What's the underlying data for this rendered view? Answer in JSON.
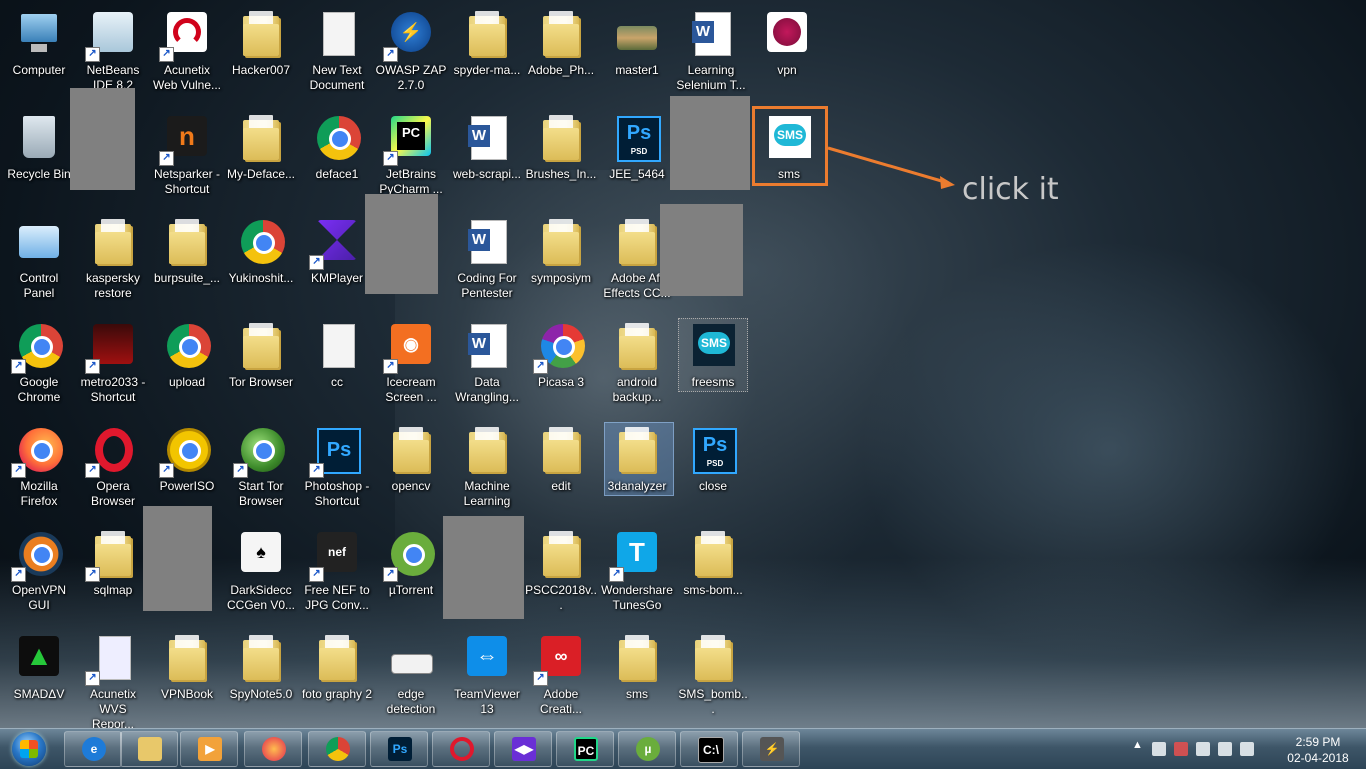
{
  "desktop": {
    "icons": [
      {
        "id": "computer",
        "label": "Computer"
      },
      {
        "id": "netbeans",
        "label": "NetBeans IDE 8.2"
      },
      {
        "id": "acunetix-web",
        "label": "Acunetix Web Vulne..."
      },
      {
        "id": "hacker007",
        "label": "Hacker007"
      },
      {
        "id": "new-text",
        "label": "New Text Document"
      },
      {
        "id": "owasp-zap",
        "label": "OWASP ZAP 2.7.0"
      },
      {
        "id": "spyder",
        "label": "spyder-ma..."
      },
      {
        "id": "adobe-ph",
        "label": "Adobe_Ph..."
      },
      {
        "id": "master1",
        "label": "master1"
      },
      {
        "id": "learning-selenium",
        "label": "Learning Selenium T..."
      },
      {
        "id": "vpn",
        "label": "vpn"
      },
      {
        "id": "recycle-bin",
        "label": "Recycle Bin"
      },
      {
        "id": "netsparker",
        "label": "Netsparker - Shortcut"
      },
      {
        "id": "my-deface",
        "label": "My-Deface..."
      },
      {
        "id": "deface1",
        "label": "deface1"
      },
      {
        "id": "pycharm",
        "label": "JetBrains PyCharm ..."
      },
      {
        "id": "web-scraping",
        "label": "web-scrapi..."
      },
      {
        "id": "brushes",
        "label": "Brushes_In..."
      },
      {
        "id": "jee",
        "label": "JEE_5464"
      },
      {
        "id": "sms",
        "label": "sms"
      },
      {
        "id": "control-panel",
        "label": "Control Panel"
      },
      {
        "id": "kaspersky",
        "label": "kaspersky restore"
      },
      {
        "id": "burpsuite",
        "label": "burpsuite_..."
      },
      {
        "id": "yukinoshita",
        "label": "Yukinoshit..."
      },
      {
        "id": "kmplayer",
        "label": "KMPlayer"
      },
      {
        "id": "coding-pentester",
        "label": "Coding For Pentester"
      },
      {
        "id": "symposiym",
        "label": "symposiym"
      },
      {
        "id": "adobe-ae",
        "label": "Adobe Aft Effects CC..."
      },
      {
        "id": "google-chrome",
        "label": "Google Chrome"
      },
      {
        "id": "metro2033",
        "label": "metro2033 - Shortcut"
      },
      {
        "id": "upload",
        "label": "upload"
      },
      {
        "id": "tor-browser",
        "label": "Tor Browser"
      },
      {
        "id": "cc",
        "label": "cc"
      },
      {
        "id": "icecream",
        "label": "Icecream Screen ..."
      },
      {
        "id": "data-wrangling",
        "label": "Data Wrangling..."
      },
      {
        "id": "picasa",
        "label": "Picasa 3"
      },
      {
        "id": "android-backup",
        "label": "android backup..."
      },
      {
        "id": "freesms",
        "label": "freesms"
      },
      {
        "id": "firefox",
        "label": "Mozilla Firefox"
      },
      {
        "id": "opera",
        "label": "Opera Browser"
      },
      {
        "id": "poweriso",
        "label": "PowerISO"
      },
      {
        "id": "start-tor",
        "label": "Start Tor Browser"
      },
      {
        "id": "photoshop",
        "label": "Photoshop - Shortcut"
      },
      {
        "id": "opencv",
        "label": "opencv"
      },
      {
        "id": "machine-learning",
        "label": "Machine Learning"
      },
      {
        "id": "edit",
        "label": "edit"
      },
      {
        "id": "3danalyzer",
        "label": "3danalyzer"
      },
      {
        "id": "close",
        "label": "close"
      },
      {
        "id": "openvpn",
        "label": "OpenVPN GUI"
      },
      {
        "id": "sqlmap",
        "label": "sqlmap"
      },
      {
        "id": "darksidecc",
        "label": "DarkSidecc CCGen V0..."
      },
      {
        "id": "free-nef",
        "label": "Free NEF to JPG Conv..."
      },
      {
        "id": "utorrent",
        "label": "µTorrent"
      },
      {
        "id": "pscc2018",
        "label": "PSCC2018v..."
      },
      {
        "id": "wondershare",
        "label": "Wondershare TunesGo"
      },
      {
        "id": "sms-bomb",
        "label": "sms-bom..."
      },
      {
        "id": "smadav",
        "label": "SMADΔV"
      },
      {
        "id": "acunetix-wvs",
        "label": "Acunetix WVS Repor..."
      },
      {
        "id": "vpnbook",
        "label": "VPNBook"
      },
      {
        "id": "spynote",
        "label": "SpyNote5.0"
      },
      {
        "id": "fotography",
        "label": "foto graphy 2"
      },
      {
        "id": "edge-detection",
        "label": "edge detection"
      },
      {
        "id": "teamviewer",
        "label": "TeamViewer 13"
      },
      {
        "id": "adobe-creative",
        "label": "Adobe Creati..."
      },
      {
        "id": "sms2",
        "label": "sms"
      },
      {
        "id": "sms-bomb2",
        "label": "SMS_bomb..."
      }
    ]
  },
  "annotation": {
    "text": "click it",
    "color": "#ec7c2f"
  },
  "taskbar": {
    "pinned": [
      "Internet Explorer",
      "Windows Explorer",
      "Media Player",
      "Firefox",
      "Google Chrome",
      "Photoshop",
      "Opera",
      "KMPlayer",
      "PyCharm",
      "µTorrent",
      "Command Prompt",
      "Burp Suite"
    ],
    "clock": {
      "time": "2:59 PM",
      "date": "02-04-2018"
    }
  }
}
